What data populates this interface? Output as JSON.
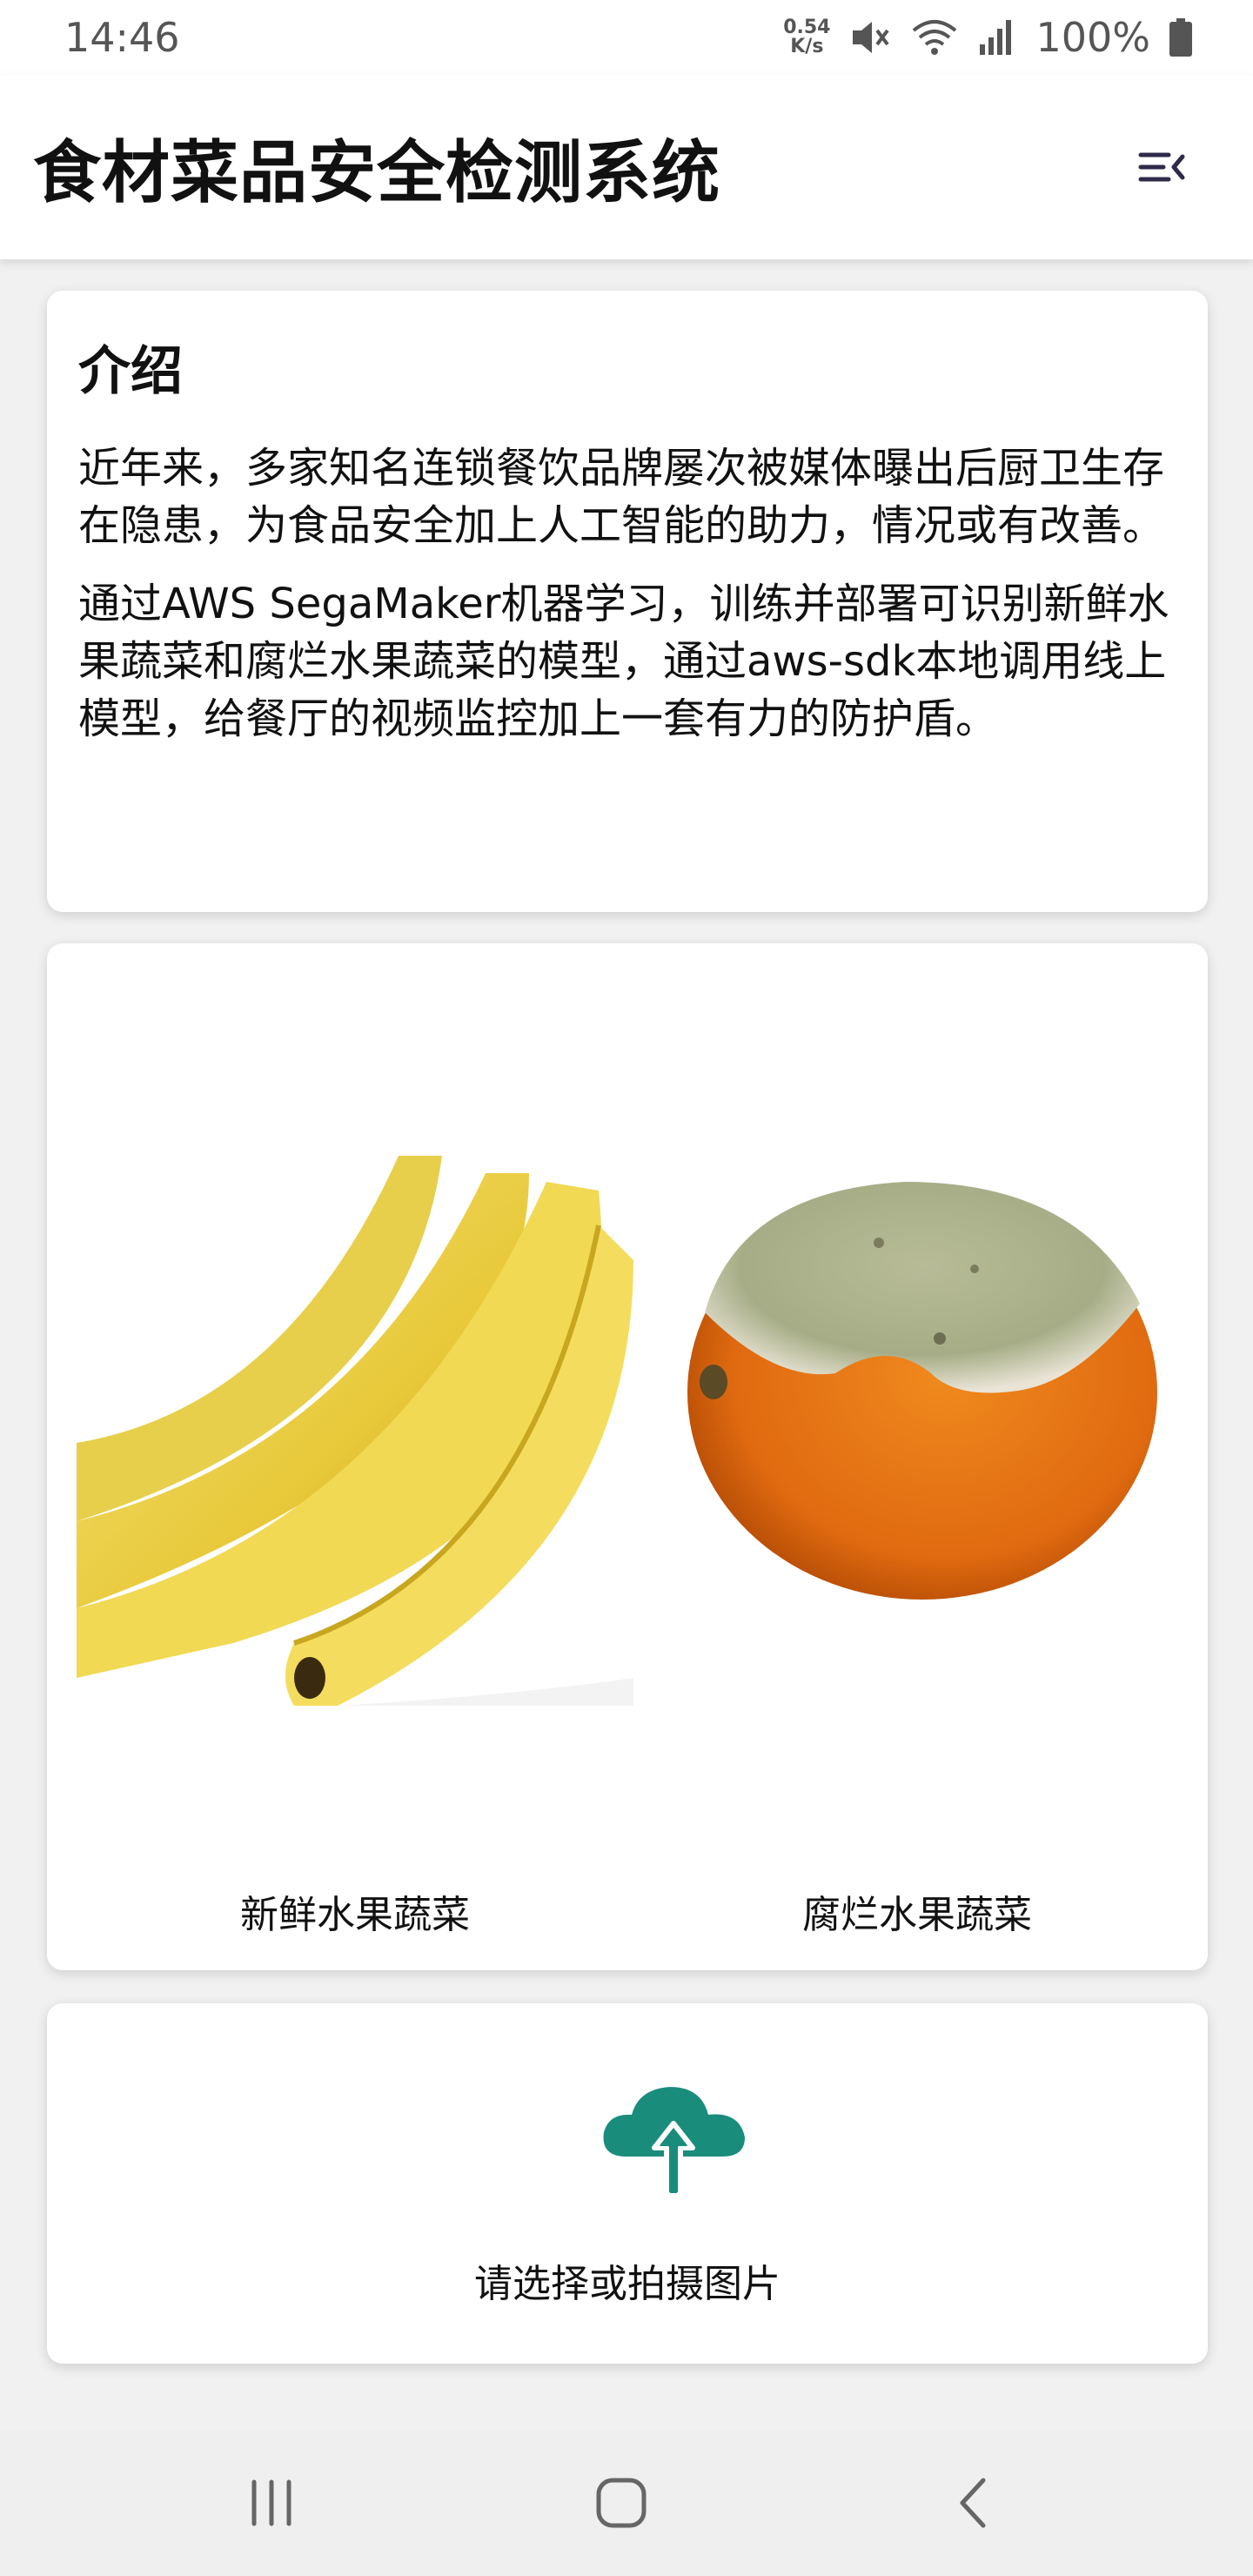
{
  "status_bar": {
    "time": "14:46",
    "net_speed_value": "0.54",
    "net_speed_unit": "K/s",
    "battery": "100%"
  },
  "app_bar": {
    "title": "食材菜品安全检测系统",
    "menu_icon": "menu-collapse-icon"
  },
  "intro": {
    "title": "介绍",
    "paragraphs": [
      "近年来，多家知名连锁餐饮品牌屡次被媒体曝出后厨卫生存在隐患，为食品安全加上人工智能的助力，情况或有改善。",
      "通过AWS SegaMaker机器学习，训练并部署可识别新鲜水果蔬菜和腐烂水果蔬菜的模型，通过aws-sdk本地调用线上模型，给餐厅的视频监控加上一套有力的防护盾。"
    ]
  },
  "examples": {
    "fresh_label": "新鲜水果蔬菜",
    "rotten_label": "腐烂水果蔬菜"
  },
  "upload": {
    "label": "请选择或拍摄图片",
    "icon": "cloud-upload-icon",
    "color": "#1a8c7c"
  },
  "nav": {
    "recent": "recent-apps-icon",
    "home": "home-icon",
    "back": "back-icon"
  }
}
